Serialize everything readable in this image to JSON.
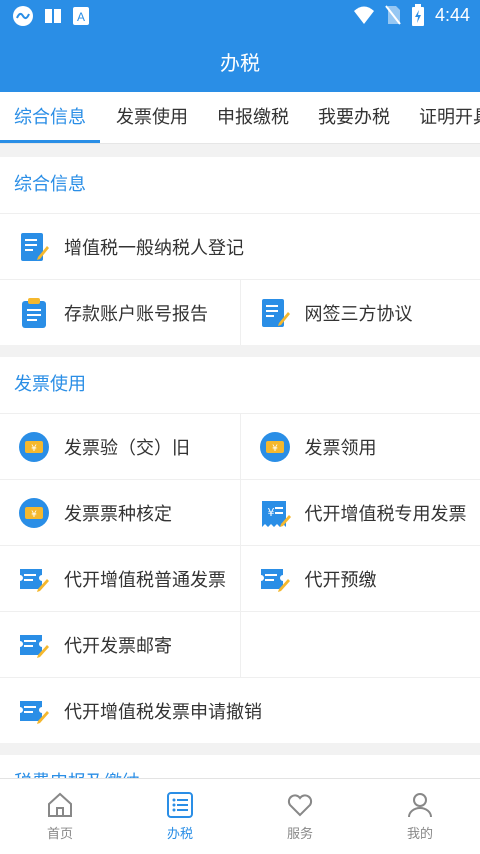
{
  "status": {
    "time": "4:44"
  },
  "title": "办税",
  "tabs": [
    "综合信息",
    "发票使用",
    "申报缴税",
    "我要办税",
    "证明开具"
  ],
  "sections": {
    "zonghe": {
      "title": "综合信息",
      "items": [
        "增值税一般纳税人登记",
        "存款账户账号报告",
        "网签三方协议"
      ]
    },
    "fapiao": {
      "title": "发票使用",
      "items": [
        "发票验（交）旧",
        "发票领用",
        "发票票种核定",
        "代开增值税专用发票",
        "代开增值税普通发票",
        "代开预缴",
        "代开发票邮寄",
        "代开增值税发票申请撤销"
      ]
    },
    "next": {
      "title": "税费申报及缴纳"
    }
  },
  "bottom_nav": [
    "首页",
    "办税",
    "服务",
    "我的"
  ],
  "colors": {
    "accent": "#2a8ee6",
    "icon_yellow": "#f5b82e"
  }
}
